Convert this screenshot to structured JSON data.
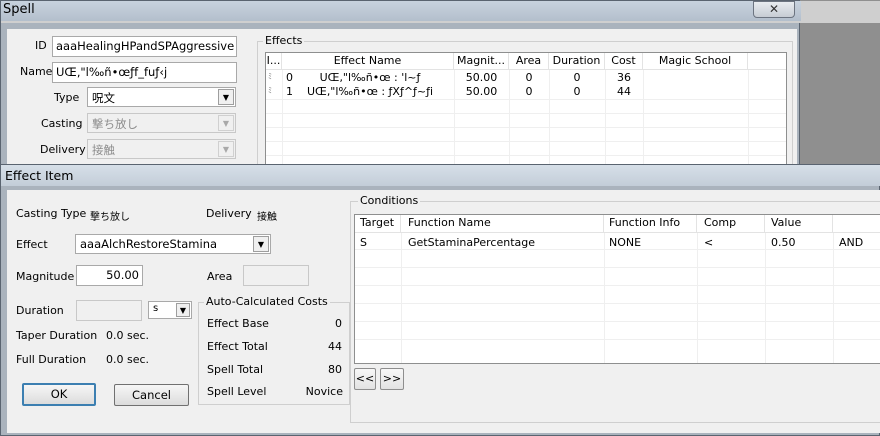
{
  "spell_window": {
    "title": "Spell",
    "close_glyph": "✕",
    "fields": {
      "id_label": "ID",
      "id_value": "aaaHealingHPandSPAggressive",
      "name_label": "Name",
      "name_value": "UŒ‚\"l‰ñ•œƒf_fuƒ‹j",
      "type_label": "Type",
      "type_value": "呪文",
      "casting_label": "Casting",
      "casting_value": "撃ち放し",
      "delivery_label": "Delivery",
      "delivery_value": "接触"
    },
    "effects_group": {
      "title": "Effects",
      "columns": [
        "I...",
        "Effect Name",
        "Magnit...",
        "Area",
        "Duration",
        "Cost",
        "Magic School"
      ],
      "rows": [
        {
          "mark": "ﾐ",
          "index": "0",
          "name": "UŒ‚\"l‰ñ•œ : 'l~ƒ",
          "magnitude": "50.00",
          "area": "0",
          "duration": "0",
          "cost": "36",
          "school": ""
        },
        {
          "mark": "ﾐ",
          "index": "1",
          "name": "UŒ‚\"l‰ñ•œ : ƒXƒ^ƒ~ƒi",
          "magnitude": "50.00",
          "area": "0",
          "duration": "0",
          "cost": "44",
          "school": ""
        }
      ]
    }
  },
  "effect_item": {
    "title": "Effect Item",
    "casting_type_label": "Casting Type",
    "casting_type_value": "撃ち放し",
    "delivery_label": "Delivery",
    "delivery_value": "接触",
    "effect_label": "Effect",
    "effect_value": "aaaAlchRestoreStamina",
    "magnitude_label": "Magnitude",
    "magnitude_value": "50.00",
    "area_label": "Area",
    "area_value": "",
    "duration_label": "Duration",
    "duration_value": "",
    "duration_unit": "s",
    "taper_duration_label": "Taper Duration",
    "taper_duration_value": "0.0 sec.",
    "full_duration_label": "Full Duration",
    "full_duration_value": "0.0 sec.",
    "auto_costs": {
      "title": "Auto-Calculated Costs",
      "effect_base_label": "Effect Base",
      "effect_base_value": "0",
      "effect_total_label": "Effect Total",
      "effect_total_value": "44",
      "spell_total_label": "Spell Total",
      "spell_total_value": "80",
      "spell_level_label": "Spell Level",
      "spell_level_value": "Novice"
    },
    "ok_label": "OK",
    "cancel_label": "Cancel",
    "conditions": {
      "title": "Conditions",
      "columns": [
        "Target",
        "Function Name",
        "Function Info",
        "Comp",
        "Value",
        ""
      ],
      "rows": [
        {
          "target": "S",
          "function_name": "GetStaminaPercentage",
          "function_info": "NONE",
          "comp": "<",
          "value": "0.50",
          "op": "AND"
        }
      ],
      "prev_label": "<<",
      "next_label": ">>"
    }
  }
}
